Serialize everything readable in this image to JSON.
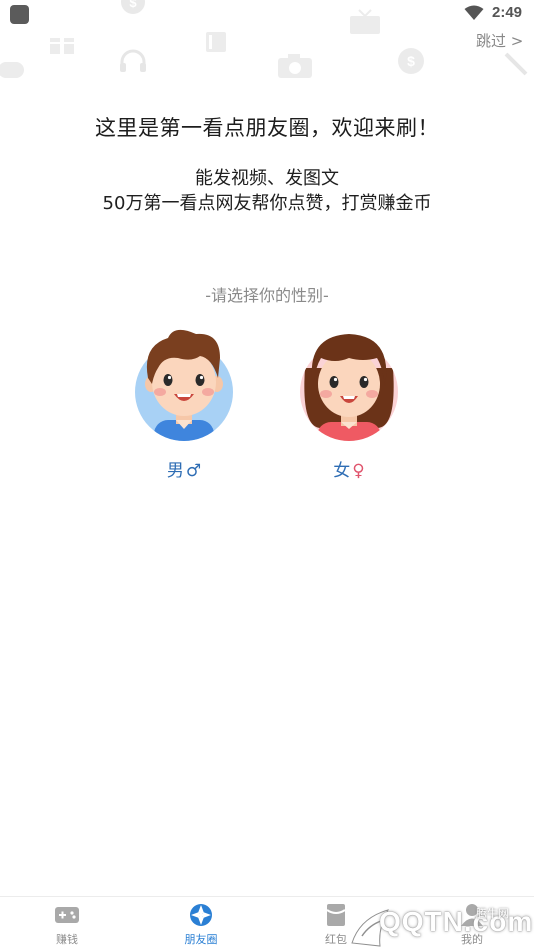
{
  "status_bar": {
    "time": "2:49"
  },
  "header": {
    "skip_label": "跳过 >"
  },
  "intro": {
    "headline": "这里是第一看点朋友圈，欢迎来刷！",
    "line1": "能发视频、发图文",
    "line2": "50万第一看点网友帮你点赞，打赏赚金币"
  },
  "gender": {
    "prompt": "-请选择你的性别-",
    "male_label": "男",
    "male_symbol": "♂",
    "female_label": "女",
    "female_symbol": "♀"
  },
  "bottom_nav": {
    "items": [
      {
        "label": "赚钱",
        "icon": "gamepad-icon",
        "active": false
      },
      {
        "label": "朋友圈",
        "icon": "aperture-icon",
        "active": true
      },
      {
        "label": "红包",
        "icon": "red-packet-icon",
        "active": false
      },
      {
        "label": "我的",
        "icon": "user-icon",
        "active": false
      }
    ]
  },
  "watermark": {
    "text": "QQTN.com",
    "tag": "腾牛网"
  },
  "colors": {
    "accent": "#2a7fd4",
    "male_bg": "#a8d1f5",
    "female_bg": "#fbd3d6",
    "female_symbol": "#e0556d"
  }
}
